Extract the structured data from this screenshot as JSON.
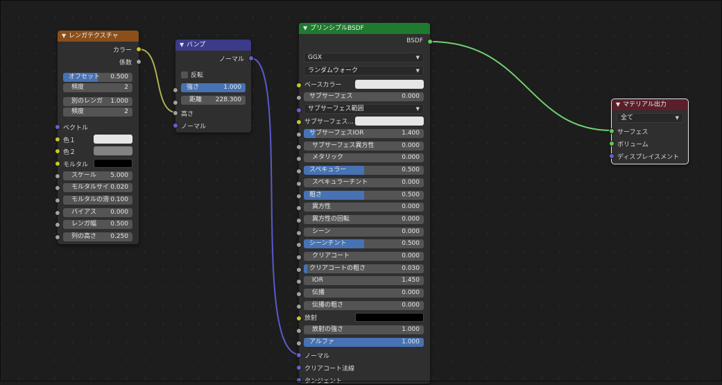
{
  "brick": {
    "title": "レンガテクスチャ",
    "out_color": "カラー",
    "out_fac": "係数",
    "fields": [
      {
        "label": "オフセット",
        "value": "0.500",
        "fill": 0.5
      },
      {
        "label": "頻度",
        "value": "2"
      },
      {
        "label": "別のレンガ",
        "value": "1.000"
      },
      {
        "label": "頻度",
        "value": "2"
      }
    ],
    "vector": "ベクトル",
    "color1": "色１",
    "color2": "色２",
    "mortar": "モルタル",
    "inputs": [
      {
        "label": "スケール",
        "value": "5.000"
      },
      {
        "label": "モルタルサイ",
        "value": "0.020"
      },
      {
        "label": "モルタルの滑",
        "value": "0.100"
      },
      {
        "label": "バイアス",
        "value": "0.000"
      },
      {
        "label": "レンガ幅",
        "value": "0.500"
      },
      {
        "label": "列の高さ",
        "value": "0.250"
      }
    ],
    "swatch_colors": [
      "#e6e6e6",
      "#838383",
      "#000000"
    ]
  },
  "bump": {
    "title": "バンプ",
    "out_normal": "ノーマル",
    "invert": "反転",
    "strength_label": "強さ",
    "strength": "1.000",
    "distance_label": "距離",
    "distance": "228.300",
    "height": "高さ",
    "normal": "ノーマル"
  },
  "bsdf": {
    "title": "プリンシプルBSDF",
    "out": "BSDF",
    "dist": "GGX",
    "sss_method": "ランダムウォーク",
    "base_color": "ベースカラー",
    "subsurface": {
      "label": "サブサーフェス",
      "value": "0.000"
    },
    "subsurface_radius": "サブサーフェス範囲",
    "subsurface_color": "サブサーフェス...",
    "fields": [
      {
        "label": "サブサーフェスIOR",
        "value": "1.400",
        "fill": 0.1
      },
      {
        "label": "サブサーフェス異方性",
        "value": "0.000",
        "fill": 0
      },
      {
        "label": "メタリック",
        "value": "0.000",
        "fill": 0
      },
      {
        "label": "スペキュラー",
        "value": "0.500",
        "fill": 0.5
      },
      {
        "label": "スペキュラーチント",
        "value": "0.000",
        "fill": 0
      },
      {
        "label": "粗さ",
        "value": "0.500",
        "fill": 0.5
      },
      {
        "label": "異方性",
        "value": "0.000",
        "fill": 0
      },
      {
        "label": "異方性の回転",
        "value": "0.000",
        "fill": 0
      },
      {
        "label": "シーン",
        "value": "0.000",
        "fill": 0
      },
      {
        "label": "シーンチント",
        "value": "0.500",
        "fill": 0.5
      },
      {
        "label": "クリアコート",
        "value": "0.000",
        "fill": 0
      },
      {
        "label": "クリアコートの粗さ",
        "value": "0.030",
        "fill": 0.03
      },
      {
        "label": "IOR",
        "value": "1.450",
        "fill": 0
      },
      {
        "label": "伝播",
        "value": "0.000",
        "fill": 0
      },
      {
        "label": "伝播の粗さ",
        "value": "0.000",
        "fill": 0
      }
    ],
    "emission": "放射",
    "emission_strength": {
      "label": "放射の強さ",
      "value": "1.000"
    },
    "alpha": {
      "label": "アルファ",
      "value": "1.000",
      "fill": 1
    },
    "normal": "ノーマル",
    "clearcoat_normal": "クリアコート法線",
    "tangent": "タンジェント",
    "colors": {
      "base": "#e6e6e6",
      "sss": "#e6e6e6",
      "emission": "#000000"
    }
  },
  "output": {
    "title": "マテリアル出力",
    "target": "全て",
    "surface": "サーフェス",
    "volume": "ボリューム",
    "displacement": "ディスプレイスメント"
  },
  "colors": {
    "brick_header": "#8a4f1a",
    "bump_header": "#3b3b8a",
    "bsdf_header": "#1f7a2f",
    "output_header": "#5a1f2b",
    "accent": "#4772b3"
  }
}
